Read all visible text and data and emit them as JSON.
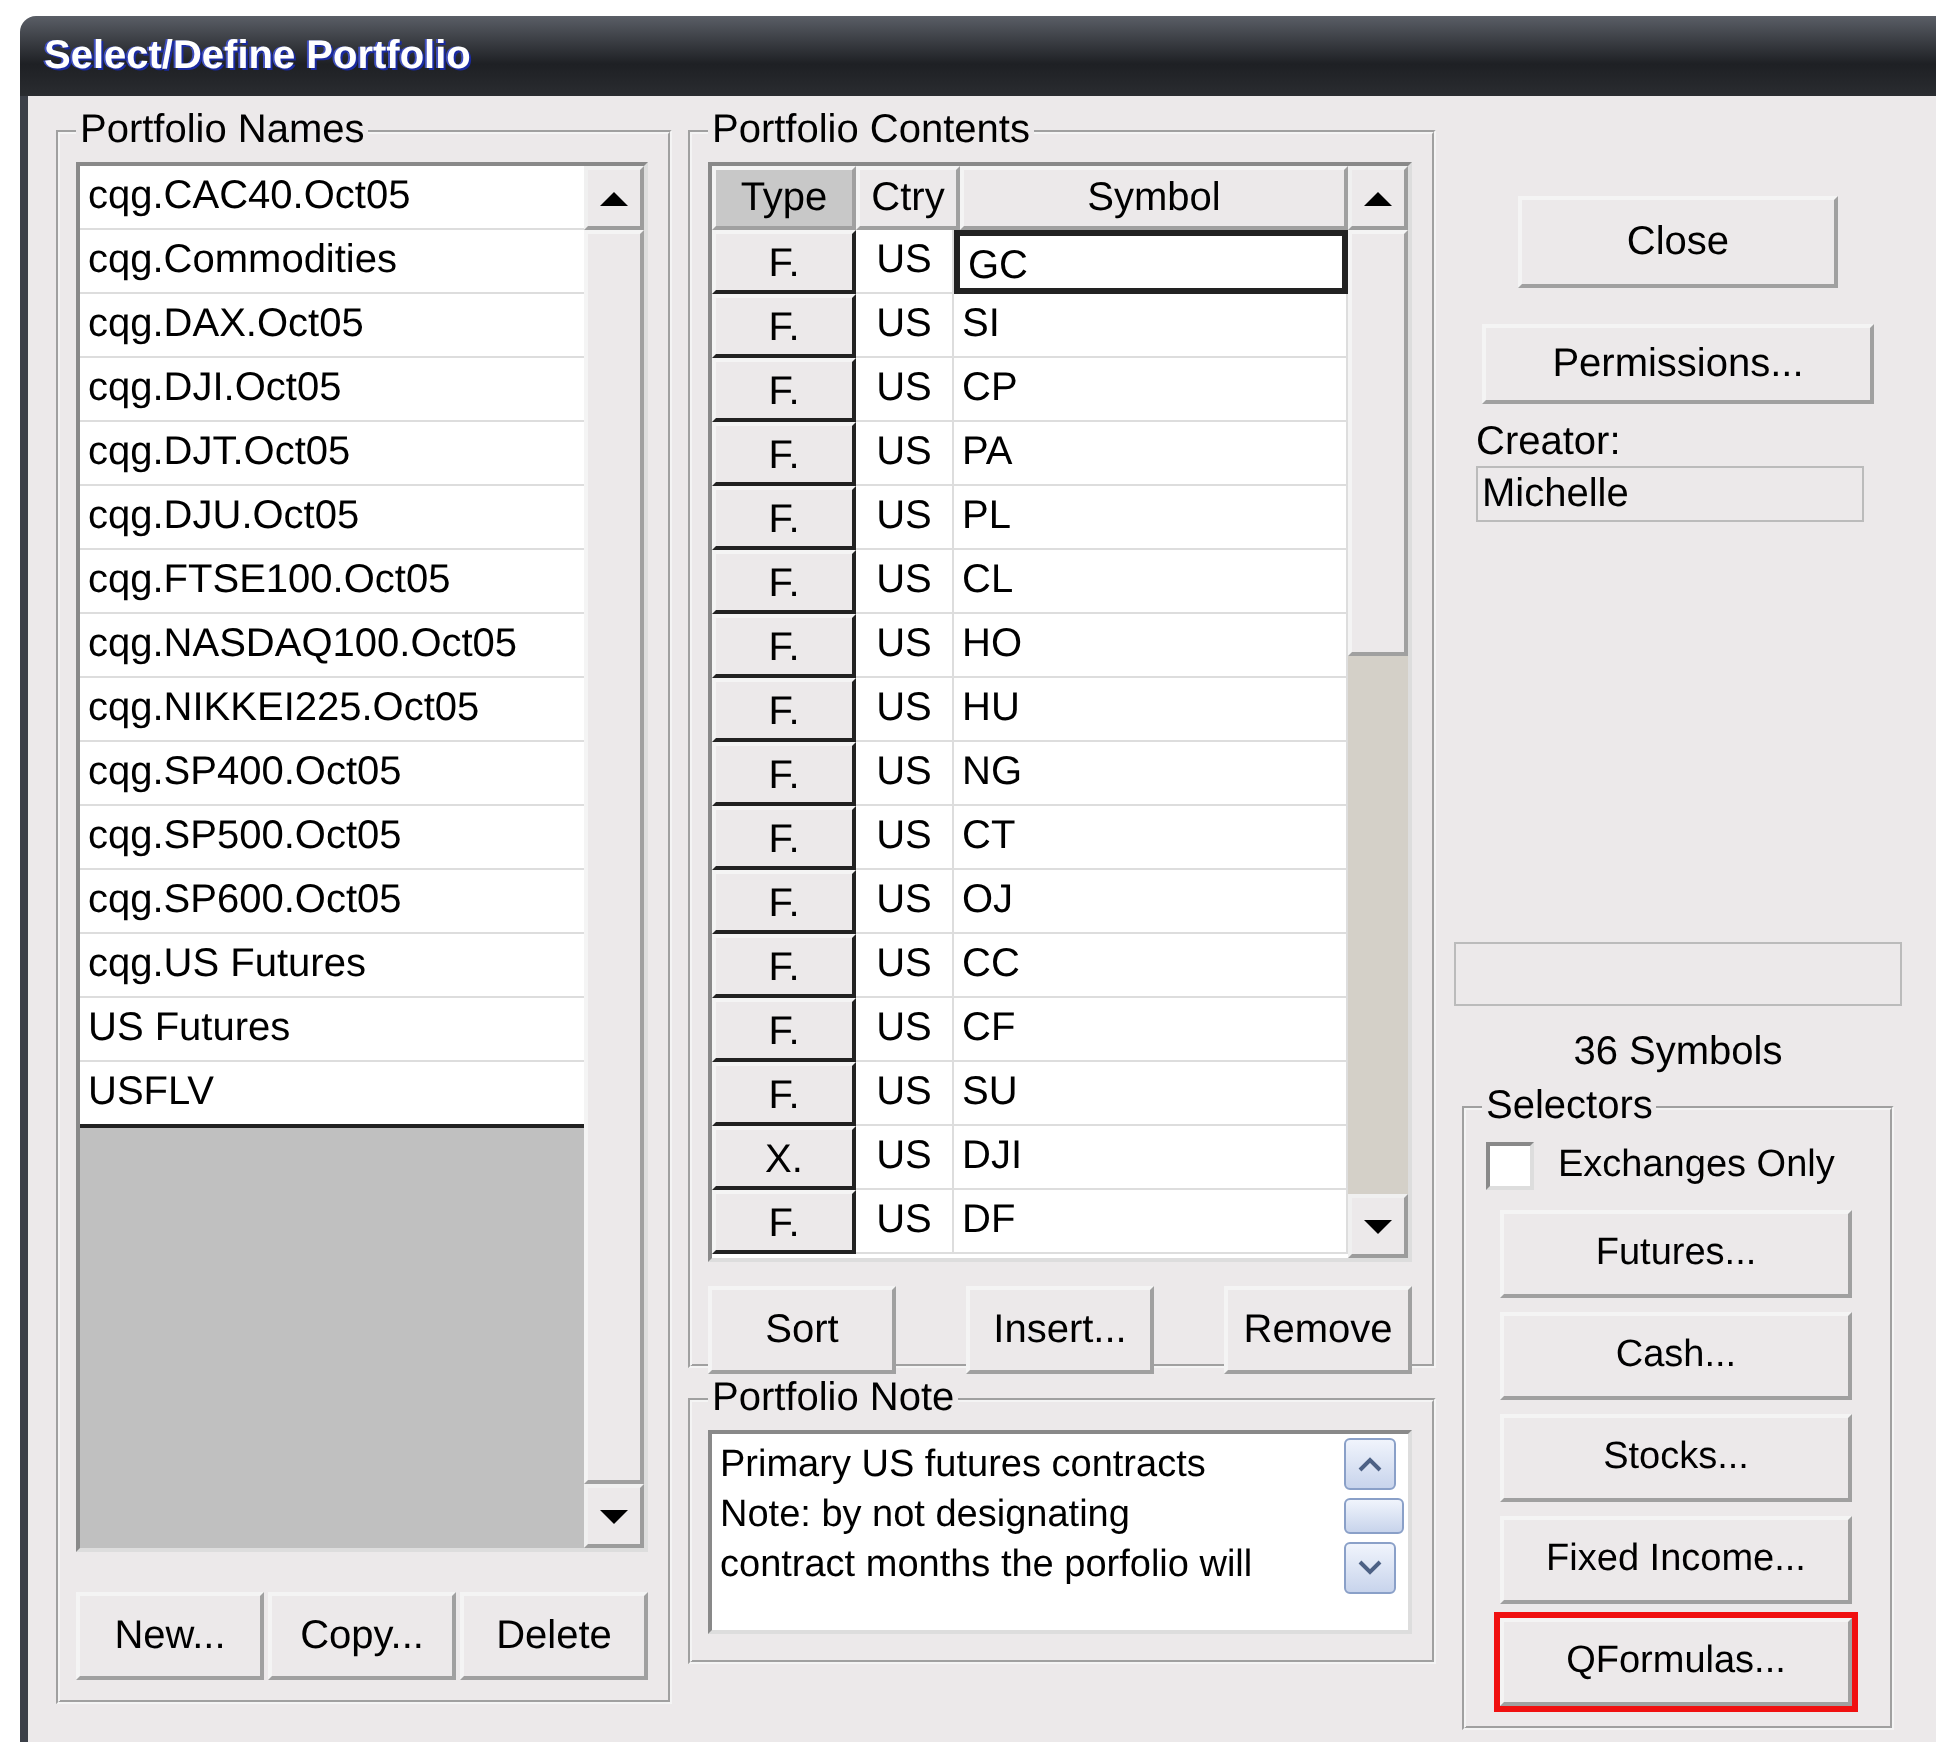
{
  "window": {
    "title": "Select/Define Portfolio"
  },
  "portfolio_names": {
    "label": "Portfolio Names",
    "items": [
      {
        "name": "cqg.CAC40.Oct05",
        "selected": false
      },
      {
        "name": "cqg.Commodities",
        "selected": false
      },
      {
        "name": "cqg.DAX.Oct05",
        "selected": false
      },
      {
        "name": "cqg.DJI.Oct05",
        "selected": false
      },
      {
        "name": "cqg.DJT.Oct05",
        "selected": false
      },
      {
        "name": "cqg.DJU.Oct05",
        "selected": false
      },
      {
        "name": "cqg.FTSE100.Oct05",
        "selected": false
      },
      {
        "name": "cqg.NASDAQ100.Oct05",
        "selected": false
      },
      {
        "name": "cqg.NIKKEI225.Oct05",
        "selected": false
      },
      {
        "name": "cqg.SP400.Oct05",
        "selected": false
      },
      {
        "name": "cqg.SP500.Oct05",
        "selected": false
      },
      {
        "name": "cqg.SP600.Oct05",
        "selected": false
      },
      {
        "name": "cqg.US Futures",
        "selected": false
      },
      {
        "name": "US Futures",
        "selected": false
      },
      {
        "name": "USFLV",
        "selected": false
      }
    ],
    "buttons": [
      "New...",
      "Copy...",
      "Delete"
    ]
  },
  "portfolio_contents": {
    "label": "Portfolio Contents",
    "columns": [
      "Type",
      "Ctry",
      "Symbol"
    ],
    "rows": [
      {
        "type": "F.",
        "ctry": "US",
        "symbol": "GC",
        "selected": true
      },
      {
        "type": "F.",
        "ctry": "US",
        "symbol": "SI",
        "selected": false
      },
      {
        "type": "F.",
        "ctry": "US",
        "symbol": "CP",
        "selected": false
      },
      {
        "type": "F.",
        "ctry": "US",
        "symbol": "PA",
        "selected": false
      },
      {
        "type": "F.",
        "ctry": "US",
        "symbol": "PL",
        "selected": false
      },
      {
        "type": "F.",
        "ctry": "US",
        "symbol": "CL",
        "selected": false
      },
      {
        "type": "F.",
        "ctry": "US",
        "symbol": "HO",
        "selected": false
      },
      {
        "type": "F.",
        "ctry": "US",
        "symbol": "HU",
        "selected": false
      },
      {
        "type": "F.",
        "ctry": "US",
        "symbol": "NG",
        "selected": false
      },
      {
        "type": "F.",
        "ctry": "US",
        "symbol": "CT",
        "selected": false
      },
      {
        "type": "F.",
        "ctry": "US",
        "symbol": "OJ",
        "selected": false
      },
      {
        "type": "F.",
        "ctry": "US",
        "symbol": "CC",
        "selected": false
      },
      {
        "type": "F.",
        "ctry": "US",
        "symbol": "CF",
        "selected": false
      },
      {
        "type": "F.",
        "ctry": "US",
        "symbol": "SU",
        "selected": false
      },
      {
        "type": "X.",
        "ctry": "US",
        "symbol": "DJI",
        "selected": false
      },
      {
        "type": "F.",
        "ctry": "US",
        "symbol": "DF",
        "selected": false
      }
    ],
    "buttons": [
      "Sort",
      "Insert...",
      "Remove"
    ]
  },
  "portfolio_note": {
    "label": "Portfolio Note",
    "lines": [
      "Primary US futures contracts",
      "Note: by not designating",
      "contract months the porfolio will"
    ]
  },
  "close_button": "Close",
  "permissions_button": "Permissions...",
  "creator": {
    "label": "Creator:",
    "value": "Michelle"
  },
  "symbol_count": "36 Symbols",
  "selectors": {
    "label": "Selectors",
    "exchanges_only": {
      "label": "Exchanges Only",
      "checked": false
    },
    "buttons": [
      {
        "label": "Futures...",
        "highlighted": false
      },
      {
        "label": "Cash...",
        "highlighted": false
      },
      {
        "label": "Stocks...",
        "highlighted": false
      },
      {
        "label": "Fixed Income...",
        "highlighted": false
      },
      {
        "label": "QFormulas...",
        "highlighted": true
      }
    ]
  }
}
